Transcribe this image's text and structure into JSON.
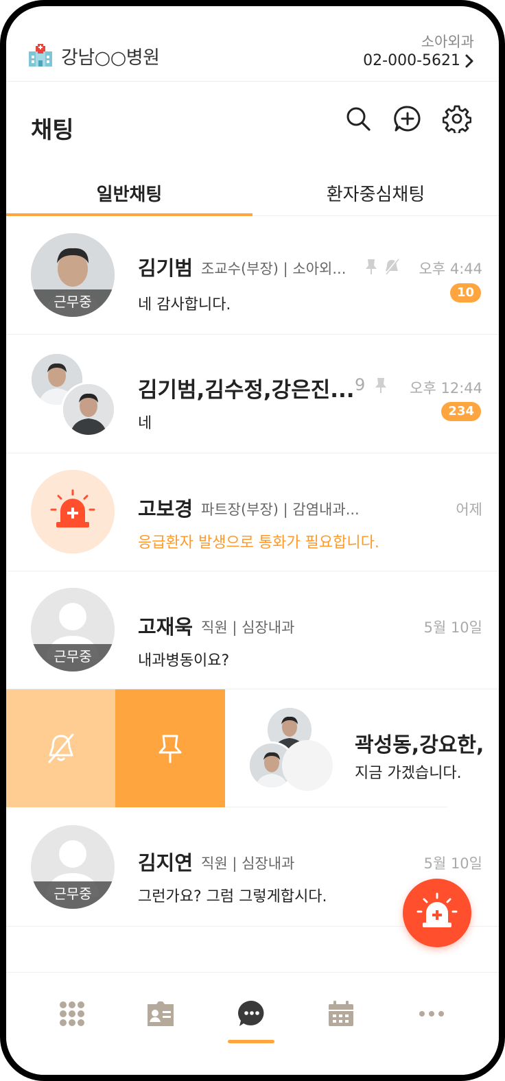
{
  "hospital": {
    "name": "강남○○병원",
    "department": "소아외과",
    "phone": "02-000-5621"
  },
  "title": "채팅",
  "tabs": [
    {
      "label": "일반채팅"
    },
    {
      "label": "환자중심채팅"
    }
  ],
  "chats": [
    {
      "name": "김기범",
      "role": "조교수(부장) | 소아외...",
      "time": "오후 4:44",
      "badge": "10",
      "message": "네 감사합니다.",
      "status": "근무중"
    },
    {
      "name": "김기범,김수정,강은진...",
      "member_count": "9",
      "time": "오후 12:44",
      "badge": "234",
      "message": "네"
    },
    {
      "name": "고보경",
      "role": "파트장(부장) | 감염내과...",
      "time": "어제",
      "message": "응급환자 발생으로 통화가 필요합니다."
    },
    {
      "name": "고재욱",
      "role": "직원 | 심장내과",
      "time": "5월 10일",
      "message": "내과병동이요?",
      "status": "근무중"
    },
    {
      "name": "곽성동,강요한,",
      "message": "지금 가겠습니다."
    },
    {
      "name": "김지연",
      "role": "직원 | 심장내과",
      "time": "5월 10일",
      "message": "그런가요? 그럼 그렇게합시다.",
      "status": "근무중"
    }
  ],
  "colors": {
    "accent": "#ffa53f",
    "accent_light": "#ffcc91",
    "emergency": "#ff4f2d",
    "alert_text": "#ff9a2a"
  },
  "icons": {
    "header": [
      "search-icon",
      "new-chat-icon",
      "settings-icon"
    ],
    "swipe": [
      "mute-icon",
      "pin-icon"
    ],
    "nav": [
      "apps-icon",
      "contacts-icon",
      "chat-icon",
      "calendar-icon",
      "more-icon"
    ],
    "fab": "emergency-siren-icon"
  }
}
